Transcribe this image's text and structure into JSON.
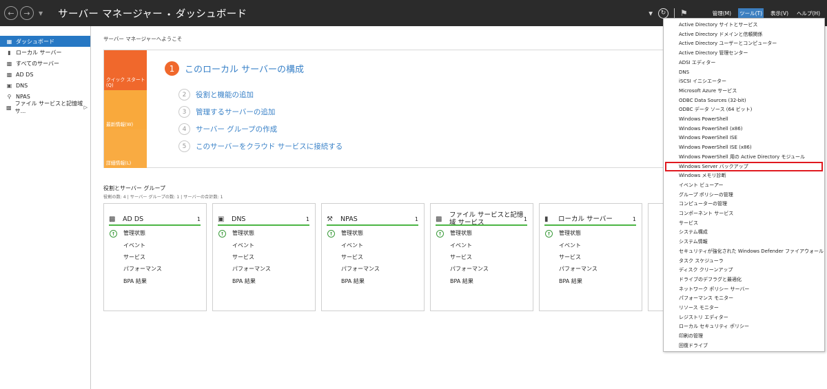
{
  "titlebar": {
    "title_app": "サーバー マネージャー",
    "title_sep": "•",
    "title_page": "ダッシュボード",
    "menus": [
      {
        "label": "管理(M)",
        "active": false
      },
      {
        "label": "ツール(T)",
        "active": true
      },
      {
        "label": "表示(V)",
        "active": false
      },
      {
        "label": "ヘルプ(H)",
        "active": false
      }
    ]
  },
  "sidebar": {
    "items": [
      {
        "label": "ダッシュボード",
        "icon": "dashboard-icon",
        "active": true
      },
      {
        "label": "ローカル サーバー",
        "icon": "server-icon",
        "active": false
      },
      {
        "label": "すべてのサーバー",
        "icon": "servers-icon",
        "active": false
      },
      {
        "label": "AD DS",
        "icon": "ad-ds-icon",
        "active": false
      },
      {
        "label": "DNS",
        "icon": "dns-icon",
        "active": false
      },
      {
        "label": "NPAS",
        "icon": "npas-icon",
        "active": false
      },
      {
        "label": "ファイル サービスと記憶域サ...",
        "icon": "file-services-icon",
        "active": false,
        "arrow": "▷"
      }
    ]
  },
  "main": {
    "welcome": "サーバー マネージャーへようこそ",
    "quickstart": {
      "tiles": [
        "クイック スタート(Q)",
        "最新情報(W)",
        "詳細情報(L)"
      ],
      "title_num": "1",
      "title": "このローカル サーバーの構成",
      "steps": [
        {
          "num": "2",
          "label": "役割と機能の追加"
        },
        {
          "num": "3",
          "label": "管理するサーバーの追加"
        },
        {
          "num": "4",
          "label": "サーバー グループの作成"
        },
        {
          "num": "5",
          "label": "このサーバーをクラウド サービスに接続する"
        }
      ]
    },
    "roles": {
      "title": "役割とサーバー グループ",
      "subtitle": "役割の数: 4 | サーバー グループの数: 1 | サーバーの合計数: 1",
      "cards": [
        {
          "name": "AD DS",
          "count": "1",
          "icon": "ad-ds-icon"
        },
        {
          "name": "DNS",
          "count": "1",
          "icon": "dns-icon"
        },
        {
          "name": "NPAS",
          "count": "1",
          "icon": "npas-icon"
        },
        {
          "name": "ファイル サービスと記憶域 サービス",
          "count": "1",
          "icon": "file-services-icon"
        },
        {
          "name": "ローカル サーバー",
          "count": "1",
          "icon": "server-icon"
        }
      ],
      "rows": [
        "管理状態",
        "イベント",
        "サービス",
        "パフォーマンス",
        "BPA 結果"
      ]
    }
  },
  "tools_menu": {
    "items": [
      "Active Directory サイトとサービス",
      "Active Directory ドメインと信頼関係",
      "Active Directory ユーザーとコンピューター",
      "Active Directory 管理センター",
      "ADSI エディター",
      "DNS",
      "iSCSI イニシエーター",
      "Microsoft Azure サービス",
      "ODBC Data Sources (32-bit)",
      "ODBC データ ソース (64 ビット)",
      "Windows PowerShell",
      "Windows PowerShell (x86)",
      "Windows PowerShell ISE",
      "Windows PowerShell ISE (x86)",
      "Windows PowerShell 用の Active Directory モジュール",
      "Windows Server バックアップ",
      "Windows メモリ診断",
      "イベント ビューアー",
      "グループ ポリシーの管理",
      "コンピューターの管理",
      "コンポーネント サービス",
      "サービス",
      "システム構成",
      "システム情報",
      "セキュリティが強化された Windows Defender ファイアウォール",
      "タスク スケジューラ",
      "ディスク クリーンアップ",
      "ドライブのデフラグと最適化",
      "ネットワーク ポリシー サーバー",
      "パフォーマンス モニター",
      "リソース モニター",
      "レジストリ エディター",
      "ローカル セキュリティ ポリシー",
      "印刷の管理",
      "回復ドライブ"
    ],
    "highlighted_index": 15,
    "highlight_color": "#e0191f"
  }
}
